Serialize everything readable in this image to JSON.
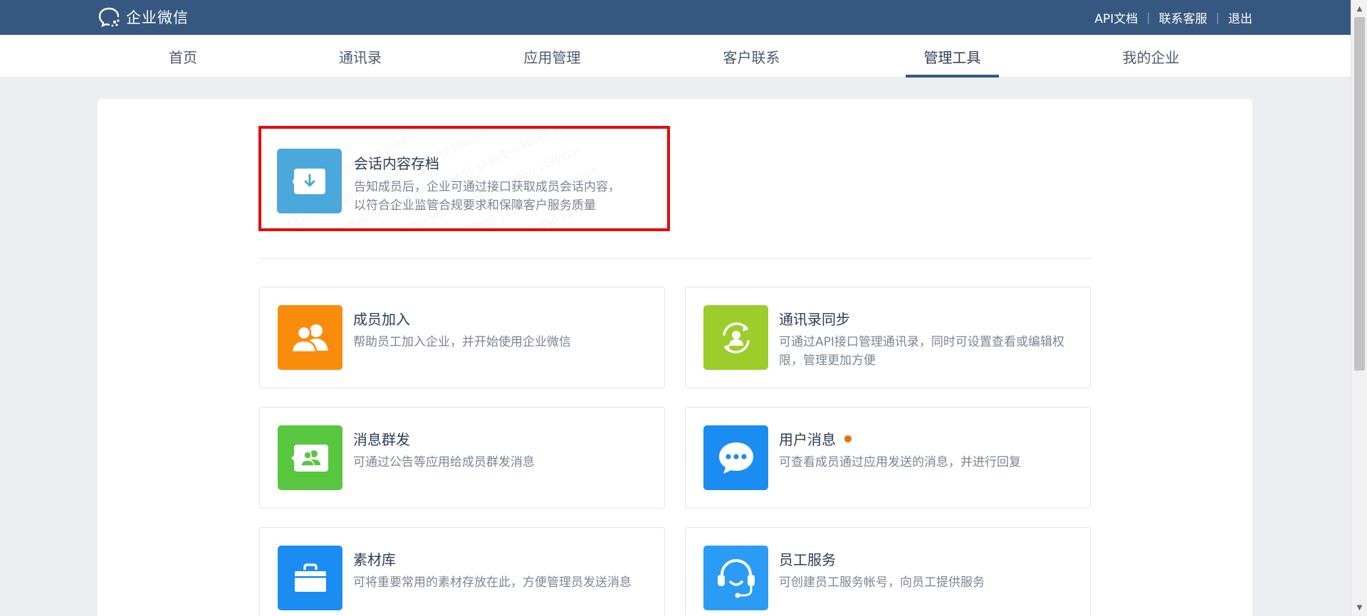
{
  "header": {
    "logo_text": "企业微信",
    "links": {
      "api_docs": "API文档",
      "contact_support": "联系客服",
      "logout": "退出"
    },
    "separator": "|"
  },
  "nav": {
    "tabs": [
      {
        "label": "首页"
      },
      {
        "label": "通讯录"
      },
      {
        "label": "应用管理"
      },
      {
        "label": "客户联系"
      },
      {
        "label": "管理工具",
        "active": true
      },
      {
        "label": "我的企业"
      }
    ]
  },
  "featured": {
    "title": "会话内容存档",
    "desc_line1": "告知成员后，企业可通过接口获取成员会话内容，",
    "desc_line2": "以符合企业监管合规要求和保障客户服务质量",
    "icon": "archive-download-icon",
    "color": "#4aa8dc",
    "highlight_color": "#e60b0b"
  },
  "tools": [
    {
      "title": "成员加入",
      "desc": "帮助员工加入企业，并开始使用企业微信",
      "icon": "members-join-icon",
      "color": "#fa8c0b"
    },
    {
      "title": "通讯录同步",
      "desc": "可通过API接口管理通讯录，同时可设置查看或编辑权限，管理更加方便",
      "icon": "contact-sync-icon",
      "color": "#9dcd2b"
    },
    {
      "title": "消息群发",
      "desc": "可通过公告等应用给成员群发消息",
      "icon": "broadcast-message-icon",
      "color": "#58c63e"
    },
    {
      "title": "用户消息",
      "desc": "可查看成员通过应用发送的消息，并进行回复",
      "icon": "chat-bubble-icon",
      "color": "#1a8cf2",
      "has_badge": true
    },
    {
      "title": "素材库",
      "desc": "可将重要常用的素材存放在此，方便管理员发送消息",
      "icon": "material-library-icon",
      "color": "#1a8cf2"
    },
    {
      "title": "员工服务",
      "desc": "可创建员工服务帐号，向员工提供服务",
      "icon": "headset-icon",
      "color": "#2a9cf5"
    }
  ],
  "colors": {
    "topbar": "#365880",
    "badge": "#f06a0f"
  }
}
